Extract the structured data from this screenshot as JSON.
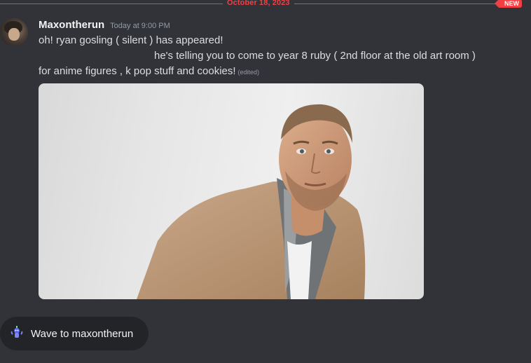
{
  "divider": {
    "date": "October 18, 2023",
    "new_label": "NEW"
  },
  "message": {
    "username": "Maxontherun",
    "timestamp": "Today at 9:00 PM",
    "lines": [
      "oh! ryan gosling ( silent ) has appeared!",
      "he's telling you to come to year 8 ruby ( 2nd floor at the old art room )",
      "for anime figures , k pop stuff and cookies!"
    ],
    "edited_label": "(edited)",
    "attachment_icon": "photo-attachment"
  },
  "wave_button": {
    "label": "Wave to maxontherun",
    "icon": "wave-sticker-icon"
  },
  "colors": {
    "background": "#313338",
    "accent_red": "#f23f43",
    "username": "#f2f3f5"
  }
}
